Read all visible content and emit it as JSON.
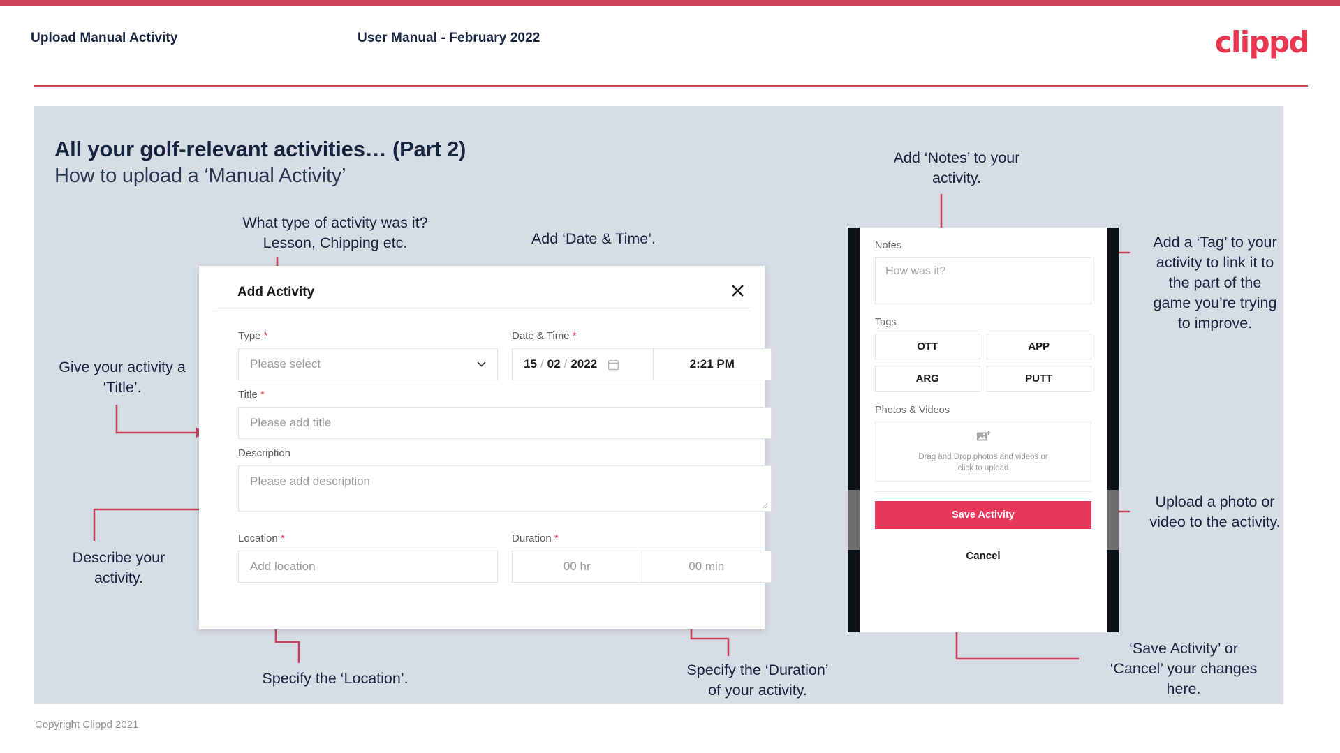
{
  "header": {
    "left_title": "Upload Manual Activity",
    "center_title": "User Manual - February 2022",
    "logo": "clippd"
  },
  "slide": {
    "heading": "All your golf-relevant activities… (Part 2)",
    "subheading": "How to upload a ‘Manual Activity’"
  },
  "annotations": {
    "type": "What type of activity was it?\nLesson, Chipping etc.",
    "datetime": "Add ‘Date & Time’.",
    "title": "Give your activity a\n‘Title’.",
    "description": "Describe your\nactivity.",
    "location": "Specify the ‘Location’.",
    "duration": "Specify the ‘Duration’\nof your activity.",
    "notes": "Add ‘Notes’ to your\nactivity.",
    "tags": "Add a ‘Tag’ to your\nactivity to link it to\nthe part of the\ngame you’re trying\nto improve.",
    "upload": "Upload a photo or\nvideo to the activity.",
    "save": "‘Save Activity’ or\n‘Cancel’ your changes\nhere."
  },
  "dialog": {
    "title": "Add Activity",
    "close_icon": "close-icon",
    "fields": {
      "type_label": "Type",
      "type_required": "*",
      "type_placeholder": "Please select",
      "datetime_label": "Date & Time",
      "datetime_required": "*",
      "date_day": "15",
      "date_month": "02",
      "date_year": "2022",
      "date_sep": "/",
      "time_value": "2:21 PM",
      "title_label": "Title",
      "title_required": "*",
      "title_placeholder": "Please add title",
      "description_label": "Description",
      "description_placeholder": "Please add description",
      "location_label": "Location",
      "location_required": "*",
      "location_placeholder": "Add location",
      "duration_label": "Duration",
      "duration_required": "*",
      "duration_hours": "00 hr",
      "duration_minutes": "00 min"
    }
  },
  "phone": {
    "notes_label": "Notes",
    "notes_placeholder": "How was it?",
    "tags_label": "Tags",
    "tags": [
      "OTT",
      "APP",
      "ARG",
      "PUTT"
    ],
    "photos_label": "Photos & Videos",
    "dropzone_line1": "Drag and Drop photos and videos or",
    "dropzone_line2": "click to upload",
    "save_button": "Save Activity",
    "cancel_button": "Cancel"
  },
  "footer": {
    "copyright": "Copyright Clippd 2021"
  },
  "colors": {
    "brand_pink": "#e8374f",
    "save_pink": "#e8375a",
    "arrow_red": "#c8405c",
    "slide_bg": "#d7dde5",
    "ink": "#16243f"
  }
}
